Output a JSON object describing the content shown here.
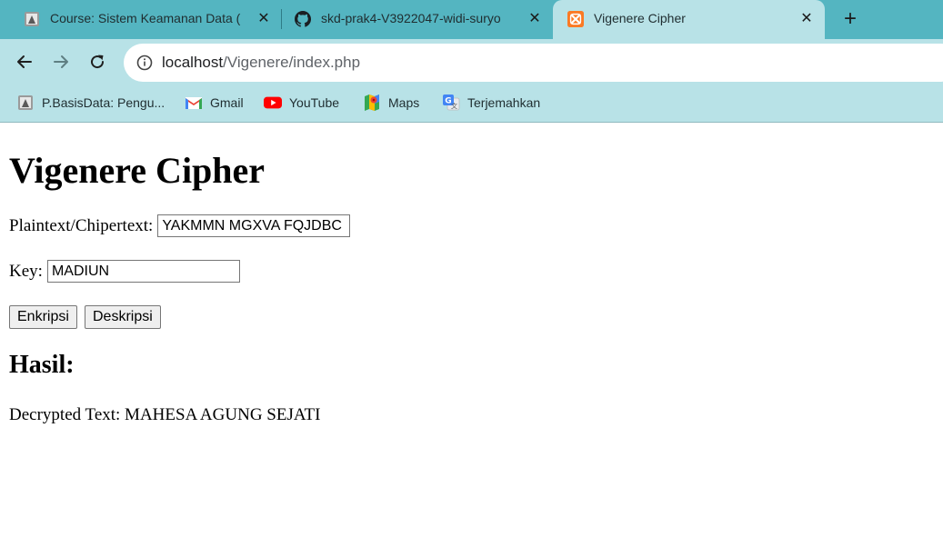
{
  "browser": {
    "tabs": [
      {
        "title": "Course: Sistem Keamanan Data (",
        "icon": "moodle-course-icon",
        "active": false
      },
      {
        "title": "skd-prak4-V3922047-widi-suryo",
        "icon": "github-icon",
        "active": false
      },
      {
        "title": "Vigenere Cipher",
        "icon": "xampp-icon",
        "active": true
      }
    ],
    "new_tab_label": "+",
    "close_label": "✕",
    "url_host": "localhost",
    "url_path": "/Vigenere/index.php",
    "bookmarks": [
      {
        "label": "P.BasisData: Pengu...",
        "icon": "moodle-bookmark-icon"
      },
      {
        "label": "Gmail",
        "icon": "gmail-icon"
      },
      {
        "label": "YouTube",
        "icon": "youtube-icon"
      },
      {
        "label": "Maps",
        "icon": "maps-icon"
      },
      {
        "label": "Terjemahkan",
        "icon": "translate-icon"
      }
    ],
    "colors": {
      "tab_strip": "#54b5c1",
      "toolbar": "#b8e2e7"
    }
  },
  "page": {
    "heading": "Vigenere Cipher",
    "text_label": "Plaintext/Chipertext:",
    "text_value": "YAKMMN MGXVA FQJDBC",
    "key_label": "Key:",
    "key_value": "MADIUN",
    "encrypt_label": "Enkripsi",
    "decrypt_label": "Deskripsi",
    "result_heading": "Hasil:",
    "result_text": "Decrypted Text: MAHESA AGUNG SEJATI"
  }
}
